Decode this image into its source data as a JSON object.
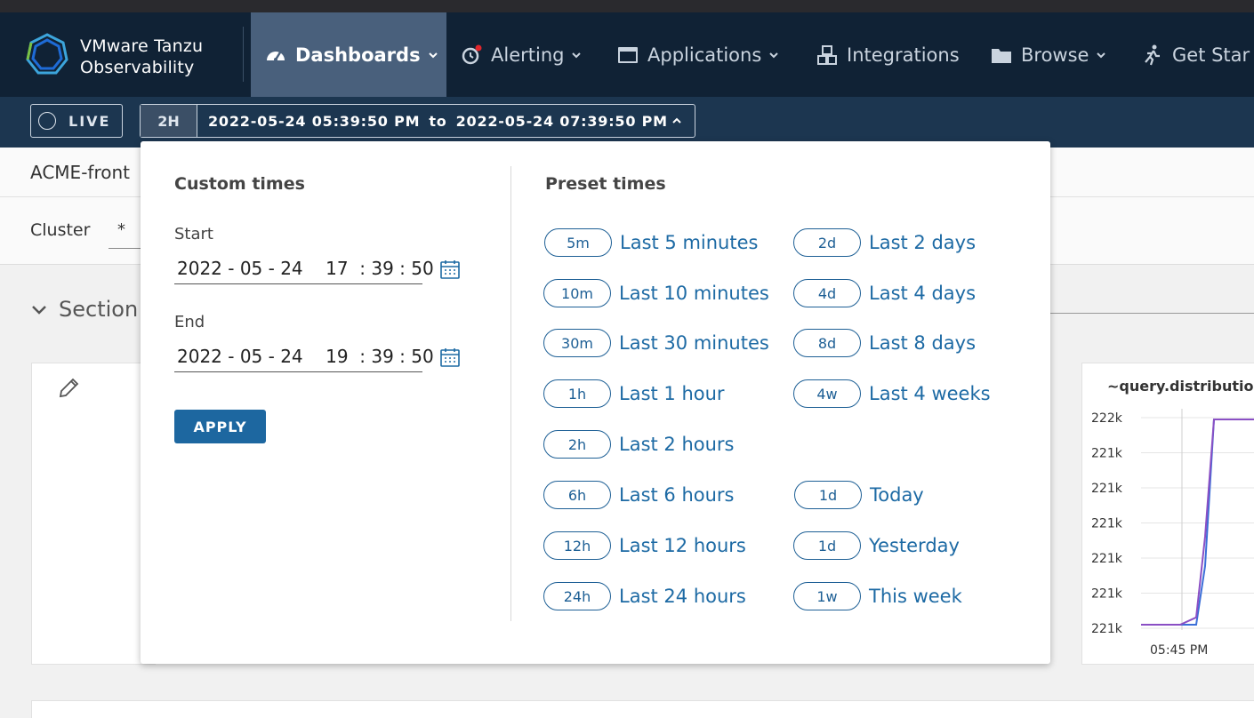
{
  "nav": {
    "brand_line1": "VMware Tanzu",
    "brand_line2": "Observability",
    "items": [
      {
        "label": "Dashboards",
        "icon": "dashboard-gauge-icon",
        "active": true
      },
      {
        "label": "Alerting",
        "icon": "alarm-clock-icon"
      },
      {
        "label": "Applications",
        "icon": "browser-window-icon"
      },
      {
        "label": "Integrations",
        "icon": "cubes-icon"
      },
      {
        "label": "Browse",
        "icon": "folder-icon"
      },
      {
        "label": "Get Star",
        "icon": "walking-person-icon"
      }
    ]
  },
  "timebar": {
    "live_label": "LIVE",
    "range_badge": "2H",
    "start_text": "2022-05-24 05:39:50 PM",
    "to_text": "to",
    "end_text": "2022-05-24 07:39:50 PM"
  },
  "page": {
    "title": "ACME-front",
    "cluster_label": "Cluster",
    "cluster_value": "*",
    "section_label": "Section"
  },
  "chart": {
    "title": "~query.distribution",
    "chart_data": {
      "type": "line",
      "y_tick_labels": [
        "222k",
        "221k",
        "221k",
        "221k",
        "221k",
        "221k",
        "221k"
      ],
      "x_tick_labels": [
        "05:45 PM"
      ],
      "series": [
        {
          "values": [
            220600,
            220600,
            220600,
            220600,
            221000,
            222000,
            222000,
            222000
          ]
        },
        {
          "values": [
            220600,
            220600,
            220600,
            220650,
            221200,
            222000,
            222000,
            222000
          ]
        }
      ]
    },
    "colors": {
      "series_a": "#3b6fd8",
      "series_b": "#8a4fc4"
    }
  },
  "dropdown": {
    "custom_heading": "Custom times",
    "start_label": "Start",
    "start_value": "2022 - 05 - 24    17  : 39 : 50",
    "end_label": "End",
    "end_value": "2022 - 05 - 24    19  : 39 : 50",
    "apply_label": "APPLY",
    "preset_heading": "Preset times",
    "presets_left": [
      {
        "badge": "5m",
        "label": "Last 5 minutes"
      },
      {
        "badge": "10m",
        "label": "Last 10 minutes"
      },
      {
        "badge": "30m",
        "label": "Last 30 minutes"
      },
      {
        "badge": "1h",
        "label": "Last 1 hour"
      },
      {
        "badge": "2h",
        "label": "Last 2 hours"
      },
      {
        "badge": "6h",
        "label": "Last 6 hours"
      },
      {
        "badge": "12h",
        "label": "Last 12 hours"
      },
      {
        "badge": "24h",
        "label": "Last 24 hours"
      }
    ],
    "presets_right": [
      {
        "badge": "2d",
        "label": "Last 2 days"
      },
      {
        "badge": "4d",
        "label": "Last 4 days"
      },
      {
        "badge": "8d",
        "label": "Last 8 days"
      },
      {
        "badge": "4w",
        "label": "Last 4 weeks"
      },
      {
        "badge": "1d",
        "label": "Today"
      },
      {
        "badge": "1d",
        "label": "Yesterday"
      },
      {
        "badge": "1w",
        "label": "This week"
      }
    ]
  },
  "colors": {
    "nav_bg": "#102235",
    "timebar_bg": "#1c3650",
    "active_tab": "#49607c",
    "link_blue": "#1d6aa4",
    "apply_blue": "#1d67a0"
  }
}
